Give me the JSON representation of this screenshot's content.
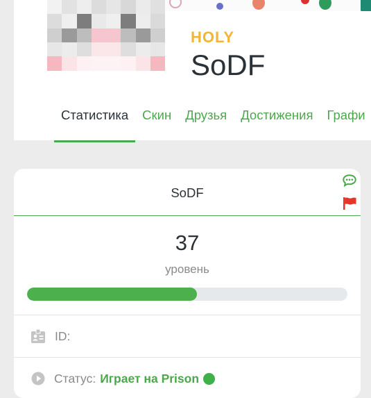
{
  "profile": {
    "rank": "HOLY",
    "name": "SoDF"
  },
  "tabs": [
    {
      "label": "Статистика",
      "active": true
    },
    {
      "label": "Скин",
      "active": false
    },
    {
      "label": "Друзья",
      "active": false
    },
    {
      "label": "Достижения",
      "active": false
    },
    {
      "label": "Графи",
      "active": false
    }
  ],
  "stats": {
    "title": "SoDF",
    "level": "37",
    "level_label": "уровень",
    "level_progress": 0.53,
    "id_label": "ID:",
    "status_label": "Статус:",
    "status_value": "Играет на Prison",
    "status_online": true
  },
  "colors": {
    "accent": "#4ca84c",
    "rank": "#f0b63a",
    "report_flag": "#e8352b"
  },
  "icons": [
    "chat-icon",
    "flag-icon",
    "id-card-icon",
    "play-icon",
    "online-dot"
  ]
}
